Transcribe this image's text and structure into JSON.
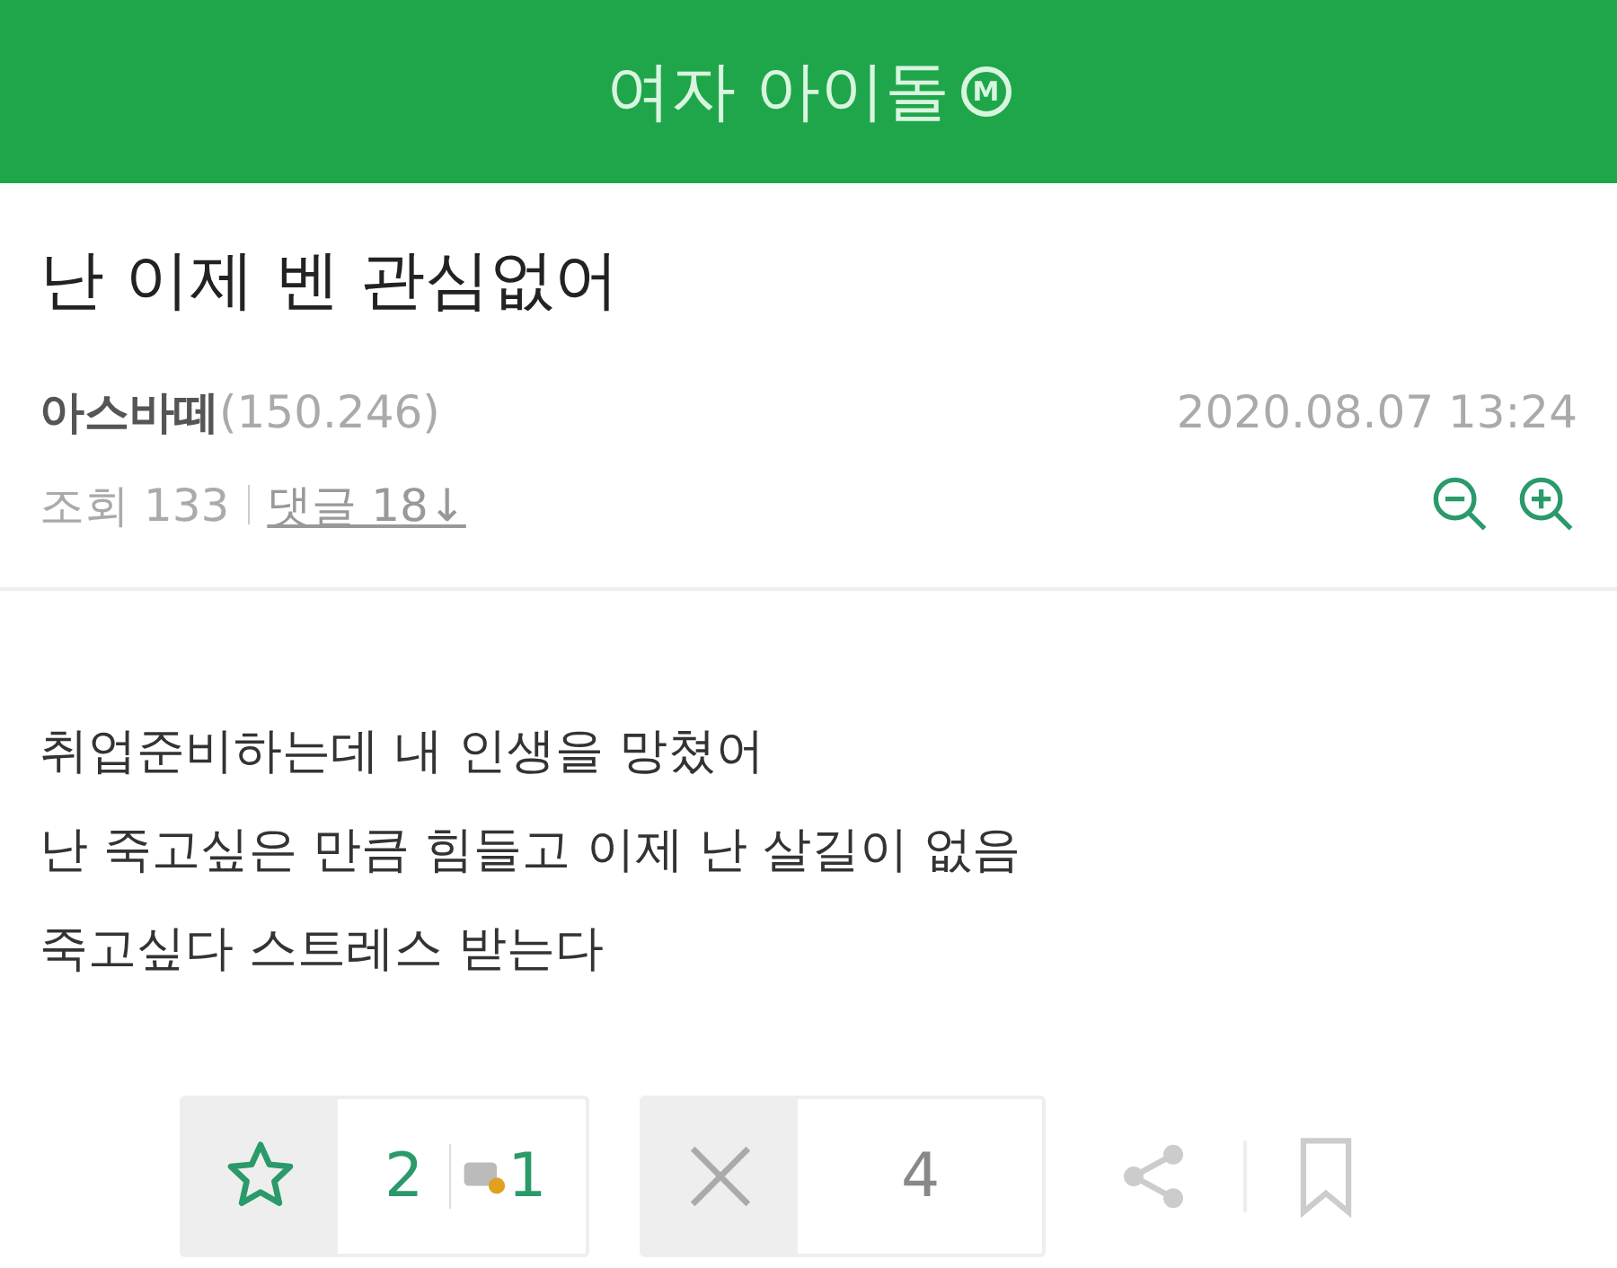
{
  "header": {
    "title": "여자 아이돌",
    "badge": "M"
  },
  "post": {
    "title": "난 이제 벤 관심없어",
    "author": "아스바떼",
    "author_id": "(150.246)",
    "date": "2020.08.07 13:24",
    "views_label": "조회",
    "views": "133",
    "comments_label": "댓글 18↓"
  },
  "body": [
    "취업준비하는데 내 인생을 망쳤어",
    "난 죽고싶은 만큼 힘들고 이제 난 살길이 없음",
    "죽고싶다 스트레스 받는다"
  ],
  "actions": {
    "recommend": "2",
    "fixed_recommend": "1",
    "dislike": "4"
  }
}
